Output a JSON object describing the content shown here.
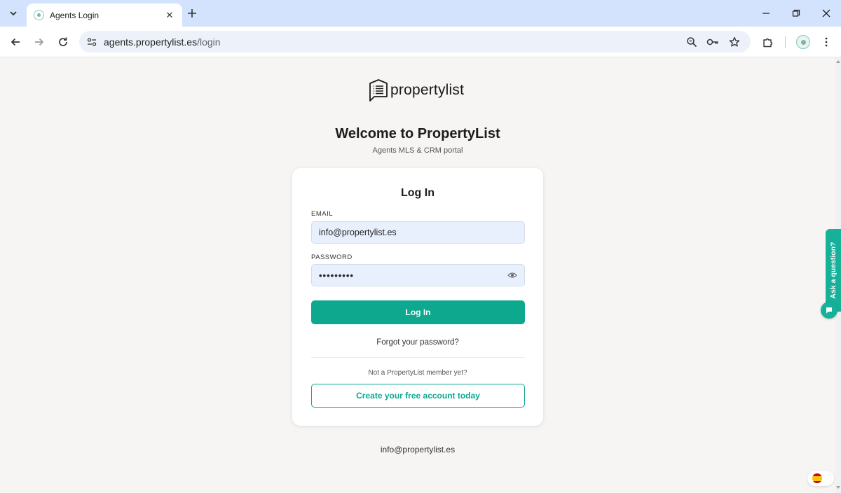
{
  "browser": {
    "tab_title": "Agents Login",
    "url_host": "agents.propertylist.es",
    "url_path": "/login",
    "icons": {
      "tab_dropdown": "chevron-down-icon",
      "tab_close": "close-icon",
      "new_tab": "plus-icon",
      "minimize": "minimize-icon",
      "restore": "restore-icon",
      "close_window": "close-icon",
      "back": "arrow-left-icon",
      "forward": "arrow-right-icon",
      "reload": "reload-icon",
      "site_info": "tune-icon",
      "zoom": "zoom-icon",
      "password": "key-icon",
      "bookmark": "star-icon",
      "extensions": "puzzle-icon",
      "profile": "avatar-icon",
      "menu": "kebab-menu-icon"
    }
  },
  "brand": {
    "logo_text": "propertylist",
    "accent_color": "#0da88e"
  },
  "header": {
    "welcome": "Welcome to PropertyList",
    "subtitle": "Agents MLS & CRM portal"
  },
  "login_card": {
    "title": "Log In",
    "email_label": "EMAIL",
    "email_value": "info@propertylist.es",
    "password_label": "PASSWORD",
    "password_mask": "•••••••••",
    "login_button": "Log In",
    "forgot_link": "Forgot your password?",
    "not_member": "Not a PropertyList member yet?",
    "create_button": "Create your free account today"
  },
  "footer": {
    "email": "info@propertylist.es"
  },
  "widgets": {
    "ask_question": "Ask a question?",
    "language_flag": "spain-flag-icon"
  }
}
